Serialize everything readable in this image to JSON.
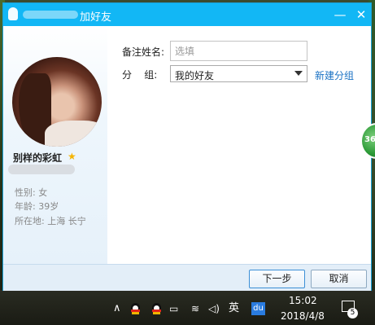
{
  "window": {
    "title_suffix": "加好友",
    "minimize_glyph": "—",
    "close_glyph": "✕"
  },
  "profile": {
    "nickname": "别样的彩虹",
    "star_glyph": "★",
    "gender": "性别: 女",
    "age": "年龄: 39岁",
    "location": "所在地: 上海  长宁"
  },
  "form": {
    "remark_label": "备注姓名:",
    "remark_placeholder": "选填",
    "remark_value": "",
    "group_label": "分    组:",
    "group_selected": "我的好友",
    "new_group_link": "新建分组"
  },
  "footer": {
    "next_button": "下一步",
    "cancel_button": "取消"
  },
  "floating_ball": {
    "text": "36"
  },
  "taskbar": {
    "chevron_glyph": "∧",
    "battery_glyph": "▭",
    "wifi_glyph": "≋",
    "volume_glyph": "◁)",
    "ime_label": "英",
    "du_label": "du",
    "time": "15:02",
    "date": "2018/4/8",
    "notification_count": "5"
  },
  "colors": {
    "titlebar": "#12b7f5",
    "link": "#1a72c4",
    "star": "#f5b400"
  }
}
